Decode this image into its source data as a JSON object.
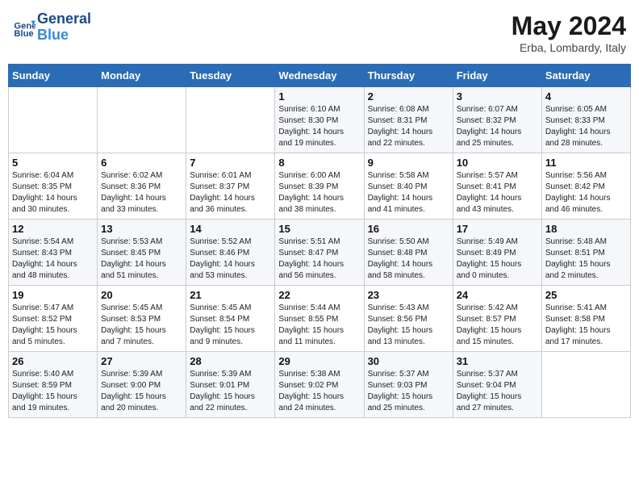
{
  "header": {
    "logo_line1": "General",
    "logo_line2": "Blue",
    "month_year": "May 2024",
    "location": "Erba, Lombardy, Italy"
  },
  "days_of_week": [
    "Sunday",
    "Monday",
    "Tuesday",
    "Wednesday",
    "Thursday",
    "Friday",
    "Saturday"
  ],
  "weeks": [
    [
      {
        "day": "",
        "info": ""
      },
      {
        "day": "",
        "info": ""
      },
      {
        "day": "",
        "info": ""
      },
      {
        "day": "1",
        "info": "Sunrise: 6:10 AM\nSunset: 8:30 PM\nDaylight: 14 hours\nand 19 minutes."
      },
      {
        "day": "2",
        "info": "Sunrise: 6:08 AM\nSunset: 8:31 PM\nDaylight: 14 hours\nand 22 minutes."
      },
      {
        "day": "3",
        "info": "Sunrise: 6:07 AM\nSunset: 8:32 PM\nDaylight: 14 hours\nand 25 minutes."
      },
      {
        "day": "4",
        "info": "Sunrise: 6:05 AM\nSunset: 8:33 PM\nDaylight: 14 hours\nand 28 minutes."
      }
    ],
    [
      {
        "day": "5",
        "info": "Sunrise: 6:04 AM\nSunset: 8:35 PM\nDaylight: 14 hours\nand 30 minutes."
      },
      {
        "day": "6",
        "info": "Sunrise: 6:02 AM\nSunset: 8:36 PM\nDaylight: 14 hours\nand 33 minutes."
      },
      {
        "day": "7",
        "info": "Sunrise: 6:01 AM\nSunset: 8:37 PM\nDaylight: 14 hours\nand 36 minutes."
      },
      {
        "day": "8",
        "info": "Sunrise: 6:00 AM\nSunset: 8:39 PM\nDaylight: 14 hours\nand 38 minutes."
      },
      {
        "day": "9",
        "info": "Sunrise: 5:58 AM\nSunset: 8:40 PM\nDaylight: 14 hours\nand 41 minutes."
      },
      {
        "day": "10",
        "info": "Sunrise: 5:57 AM\nSunset: 8:41 PM\nDaylight: 14 hours\nand 43 minutes."
      },
      {
        "day": "11",
        "info": "Sunrise: 5:56 AM\nSunset: 8:42 PM\nDaylight: 14 hours\nand 46 minutes."
      }
    ],
    [
      {
        "day": "12",
        "info": "Sunrise: 5:54 AM\nSunset: 8:43 PM\nDaylight: 14 hours\nand 48 minutes."
      },
      {
        "day": "13",
        "info": "Sunrise: 5:53 AM\nSunset: 8:45 PM\nDaylight: 14 hours\nand 51 minutes."
      },
      {
        "day": "14",
        "info": "Sunrise: 5:52 AM\nSunset: 8:46 PM\nDaylight: 14 hours\nand 53 minutes."
      },
      {
        "day": "15",
        "info": "Sunrise: 5:51 AM\nSunset: 8:47 PM\nDaylight: 14 hours\nand 56 minutes."
      },
      {
        "day": "16",
        "info": "Sunrise: 5:50 AM\nSunset: 8:48 PM\nDaylight: 14 hours\nand 58 minutes."
      },
      {
        "day": "17",
        "info": "Sunrise: 5:49 AM\nSunset: 8:49 PM\nDaylight: 15 hours\nand 0 minutes."
      },
      {
        "day": "18",
        "info": "Sunrise: 5:48 AM\nSunset: 8:51 PM\nDaylight: 15 hours\nand 2 minutes."
      }
    ],
    [
      {
        "day": "19",
        "info": "Sunrise: 5:47 AM\nSunset: 8:52 PM\nDaylight: 15 hours\nand 5 minutes."
      },
      {
        "day": "20",
        "info": "Sunrise: 5:45 AM\nSunset: 8:53 PM\nDaylight: 15 hours\nand 7 minutes."
      },
      {
        "day": "21",
        "info": "Sunrise: 5:45 AM\nSunset: 8:54 PM\nDaylight: 15 hours\nand 9 minutes."
      },
      {
        "day": "22",
        "info": "Sunrise: 5:44 AM\nSunset: 8:55 PM\nDaylight: 15 hours\nand 11 minutes."
      },
      {
        "day": "23",
        "info": "Sunrise: 5:43 AM\nSunset: 8:56 PM\nDaylight: 15 hours\nand 13 minutes."
      },
      {
        "day": "24",
        "info": "Sunrise: 5:42 AM\nSunset: 8:57 PM\nDaylight: 15 hours\nand 15 minutes."
      },
      {
        "day": "25",
        "info": "Sunrise: 5:41 AM\nSunset: 8:58 PM\nDaylight: 15 hours\nand 17 minutes."
      }
    ],
    [
      {
        "day": "26",
        "info": "Sunrise: 5:40 AM\nSunset: 8:59 PM\nDaylight: 15 hours\nand 19 minutes."
      },
      {
        "day": "27",
        "info": "Sunrise: 5:39 AM\nSunset: 9:00 PM\nDaylight: 15 hours\nand 20 minutes."
      },
      {
        "day": "28",
        "info": "Sunrise: 5:39 AM\nSunset: 9:01 PM\nDaylight: 15 hours\nand 22 minutes."
      },
      {
        "day": "29",
        "info": "Sunrise: 5:38 AM\nSunset: 9:02 PM\nDaylight: 15 hours\nand 24 minutes."
      },
      {
        "day": "30",
        "info": "Sunrise: 5:37 AM\nSunset: 9:03 PM\nDaylight: 15 hours\nand 25 minutes."
      },
      {
        "day": "31",
        "info": "Sunrise: 5:37 AM\nSunset: 9:04 PM\nDaylight: 15 hours\nand 27 minutes."
      },
      {
        "day": "",
        "info": ""
      }
    ]
  ]
}
